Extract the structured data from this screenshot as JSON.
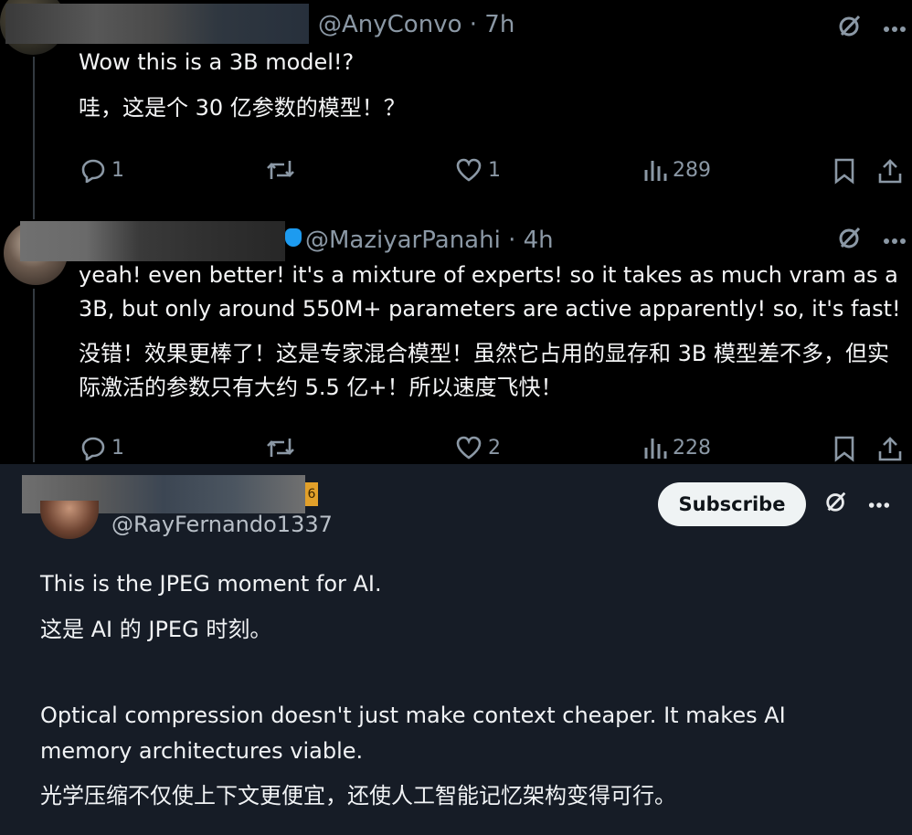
{
  "posts": [
    {
      "handle": "@AnyConvo · 7h",
      "text_en": "Wow this is a 3B model!?",
      "text_zh": "哇，这是个 30 亿参数的模型！？",
      "reply_count": "1",
      "like_count": "1",
      "view_count": "289"
    },
    {
      "handle": "@MaziyarPanahi · 4h",
      "text_en": "yeah! even better! it's a mixture of experts! so it takes as much vram as a 3B, but only around 550M+ parameters are active apparently! so, it's fast!",
      "text_zh": "没错！效果更棒了！这是专家混合模型！虽然它占用的显存和 3B 模型差不多，但实际激活的参数只有大约 5.5 亿+！所以速度飞快！",
      "reply_count": "1",
      "like_count": "2",
      "view_count": "228"
    }
  ],
  "reply_post": {
    "badge": "6",
    "handle": "@RayFernando1337",
    "subscribe_label": "Subscribe",
    "line1_en": "This is the JPEG moment for AI.",
    "line1_zh": "这是 AI 的 JPEG 时刻。",
    "line2_en": "Optical compression doesn't just make context cheaper. It makes AI memory architectures viable.",
    "line2_zh": "光学压缩不仅使上下文更便宜，还使人工智能记忆架构变得可行。"
  },
  "colors": {
    "top_background": "#000000",
    "bottom_background": "#161c26",
    "muted_text": "#8b98a5",
    "verified_blue": "#1d9bf0"
  },
  "icons": [
    "reply-icon",
    "retweet-icon",
    "like-icon",
    "views-icon",
    "bookmark-icon",
    "share-icon",
    "grok-icon",
    "more-icon"
  ]
}
